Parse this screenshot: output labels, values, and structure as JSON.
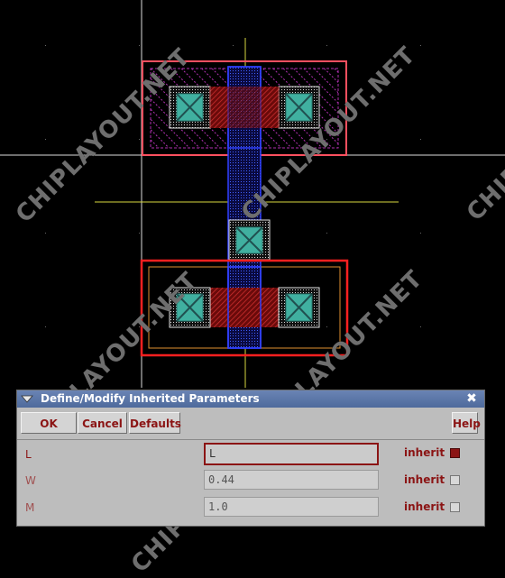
{
  "watermark": "CHIPLAYOUT.NET",
  "dialog": {
    "title": "Define/Modify Inherited Parameters",
    "close_glyph": "✖",
    "buttons": {
      "ok": "OK",
      "cancel": "Cancel",
      "defaults": "Defaults",
      "help": "Help"
    },
    "rows": [
      {
        "label": "L",
        "value": "L",
        "inherit_label": "inherit",
        "inherit_checked": true
      },
      {
        "label": "W",
        "value": "0.44",
        "inherit_label": "inherit",
        "inherit_checked": false
      },
      {
        "label": "M",
        "value": "1.0",
        "inherit_label": "inherit",
        "inherit_checked": false
      }
    ]
  },
  "colors": {
    "background": "#000000",
    "cell_outline": "#ff4040",
    "poly": "#3040ff",
    "diffusion_red": "#c02020",
    "contact": "#40c0a0",
    "crosshair": "#e0e040",
    "nwell_hatch": "#a020a0"
  }
}
